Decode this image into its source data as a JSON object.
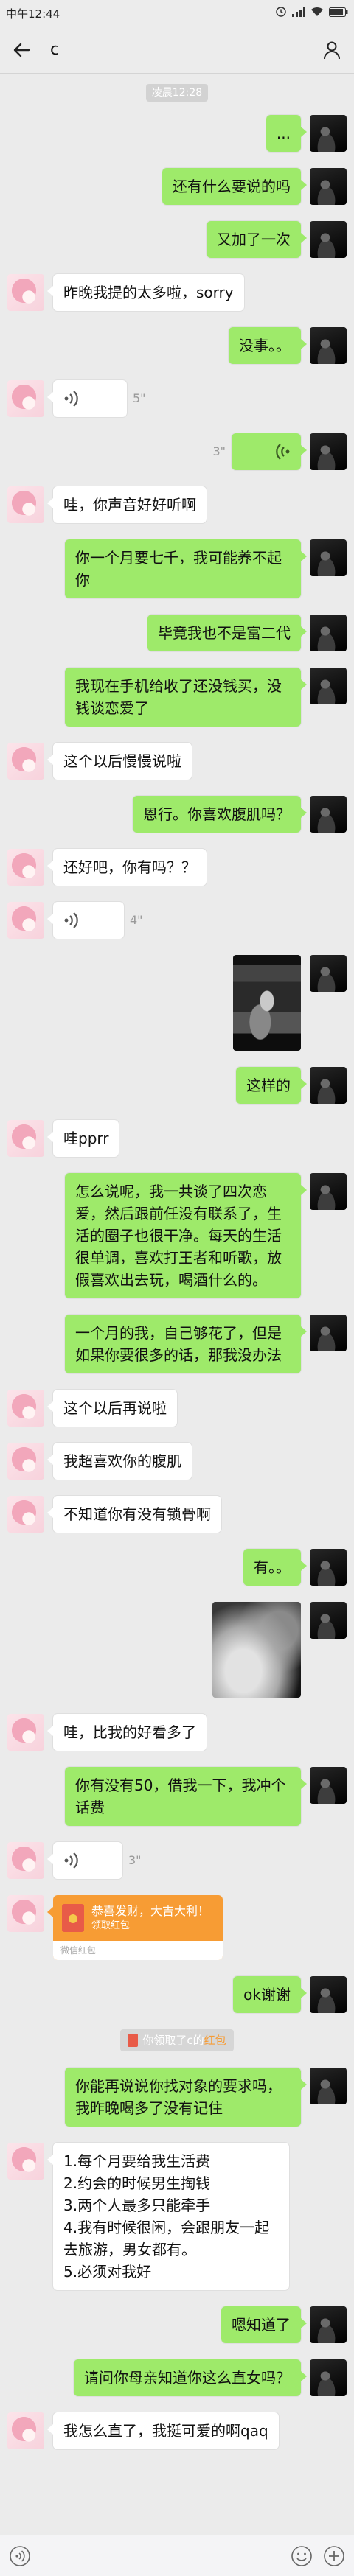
{
  "status_bar": {
    "time": "中午12:44",
    "icons": [
      "alarm-icon",
      "signal-icon",
      "wifi-icon",
      "battery-icon"
    ]
  },
  "header": {
    "title": "c",
    "left_icon": "back-arrow-icon",
    "right_icon": "person-icon"
  },
  "timestamp": "凌晨12:28",
  "messages": [
    {
      "from_me": true,
      "text": "..."
    },
    {
      "from_me": true,
      "text": "还有什么要说的吗"
    },
    {
      "from_me": true,
      "text": "又加了一次"
    },
    {
      "from_me": false,
      "text": "昨晚我提的太多啦，sorry"
    },
    {
      "from_me": true,
      "text": "没事。。"
    },
    {
      "from_me": false,
      "voice_duration": "5\""
    },
    {
      "from_me": true,
      "voice_duration": "3\""
    },
    {
      "from_me": false,
      "text": "哇，你声音好好听啊"
    },
    {
      "from_me": true,
      "text": "你一个月要七千，我可能养不起你"
    },
    {
      "from_me": true,
      "text": "毕竟我也不是富二代"
    },
    {
      "from_me": true,
      "text": "我现在手机给收了还没钱买，没钱谈恋爱了"
    },
    {
      "from_me": false,
      "text": "这个以后慢慢说啦"
    },
    {
      "from_me": true,
      "text": "恩行。你喜欢腹肌吗？"
    },
    {
      "from_me": false,
      "text": "还好吧，你有吗？？"
    },
    {
      "from_me": false,
      "voice_duration": "4\""
    },
    {
      "from_me": true,
      "image": true
    },
    {
      "from_me": true,
      "text": "这样的"
    },
    {
      "from_me": false,
      "text": "哇pprr"
    },
    {
      "from_me": true,
      "text": "怎么说呢，我一共谈了四次恋爱，然后跟前任没有联系了，生活的圈子也很干净。每天的生活很单调，喜欢打王者和听歌，放假喜欢出去玩，喝酒什么的。"
    },
    {
      "from_me": true,
      "text": "一个月的我，自己够花了，但是如果你要很多的话，那我没办法"
    },
    {
      "from_me": false,
      "text": "这个以后再说啦"
    },
    {
      "from_me": false,
      "text": "我超喜欢你的腹肌"
    },
    {
      "from_me": false,
      "text": "不知道你有没有锁骨啊"
    },
    {
      "from_me": true,
      "text": "有。。"
    },
    {
      "from_me": true,
      "image": true
    },
    {
      "from_me": false,
      "text": "哇，比我的好看多了"
    },
    {
      "from_me": true,
      "text": "你有没有50，借我一下，我冲个话费"
    },
    {
      "from_me": false,
      "voice_duration": "3\""
    },
    {
      "from_me": false,
      "red_packet": {
        "greeting": "恭喜发财，大吉大利！",
        "action": "领取红包",
        "footer": "微信红包"
      }
    },
    {
      "from_me": true,
      "text": "ok谢谢"
    },
    {
      "notice": {
        "text": "你领取了c的",
        "link": "红包"
      }
    },
    {
      "from_me": true,
      "text": "你能再说说你找对象的要求吗，我昨晚喝多了没有记住"
    },
    {
      "from_me": false,
      "lines": [
        "1.每个月要给我生活费",
        "2.约会的时候男生掏钱",
        "3.两个人最多只能牵手",
        "4.我有时候很闲，会跟朋友一起去旅游，男女都有。",
        "5.必须对我好"
      ]
    },
    {
      "from_me": true,
      "text": "嗯知道了"
    },
    {
      "from_me": true,
      "text": "请问你母亲知道你这么直女吗？"
    },
    {
      "from_me": false,
      "text": "我怎么直了，我挺可爱的啊qaq"
    }
  ],
  "input_bar": {
    "value": "",
    "left_icon": "voice-mode-icon",
    "emoji_icon": "emoji-icon",
    "plus_icon": "plus-icon"
  },
  "colors": {
    "chat_background": "#ebebeb",
    "sent_bubble": "#9eea6a",
    "received_bubble": "#ffffff",
    "red_packet": "#f79c34",
    "red_packet_link": "#f79c34"
  }
}
